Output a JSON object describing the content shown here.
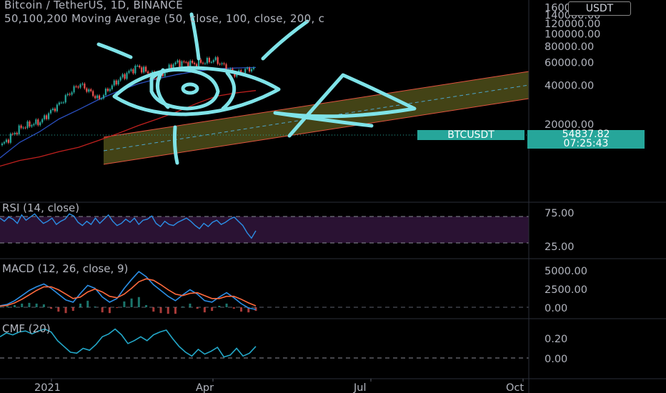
{
  "header": {
    "title": "Bitcoin / TetherUS, 1D, BINANCE",
    "indicator": "50,100,200 Moving Average (50, close, 100, close, 200, c"
  },
  "unit_button": "USDT",
  "price_label": {
    "symbol": "BTCUSDT",
    "price": "54837.82",
    "countdown": "07:25:43"
  },
  "colors": {
    "background": "#000000",
    "price": "#26a69a",
    "channel_fill": "#5a5a1e",
    "channel_line": "#e0533f",
    "drawing": "#7fe3e8",
    "rsi": "#2b8fe6",
    "rsi_band": "#2a1233",
    "macd": "#2b8fe6",
    "macd_signal": "#ff6a3d",
    "cmf": "#23a8c9",
    "ma50": "#2a4fbf",
    "ma200": "#c0201e",
    "text": "#b2b5be"
  },
  "chart_data": [
    {
      "type": "line",
      "name": "price",
      "x_ticks": [
        "2021",
        "Apr",
        "Jul",
        "Oct"
      ],
      "y_ticks": [
        20000,
        40000,
        60000,
        80000,
        100000,
        120000,
        140000,
        160000
      ],
      "ylim": [
        5000,
        165000
      ],
      "scale": "log",
      "x": [
        "2020-11-01",
        "2020-12-01",
        "2020-12-15",
        "2021-01-01",
        "2021-01-08",
        "2021-01-22",
        "2021-02-08",
        "2021-02-21",
        "2021-03-01",
        "2021-03-13",
        "2021-04-01",
        "2021-04-14",
        "2021-04-25",
        "2021-05-03"
      ],
      "values": [
        13800,
        19000,
        21000,
        29000,
        41000,
        31000,
        44000,
        56000,
        45000,
        60000,
        58800,
        63000,
        49000,
        54800
      ],
      "ma50": [
        11000,
        14500,
        17500,
        22000,
        26000,
        31000,
        36000,
        41000,
        45000,
        48500,
        51500,
        53800,
        54500,
        55000
      ],
      "ma200": [
        9500,
        10500,
        11200,
        12300,
        13300,
        15000,
        17000,
        19500,
        22000,
        25000,
        29000,
        33000,
        35000,
        36500
      ],
      "current": 54837.82
    },
    {
      "type": "line",
      "name": "RSI (14, close)",
      "levels": [
        75,
        25
      ],
      "ylim": [
        10,
        90
      ],
      "values": [
        72,
        66,
        74,
        70,
        62,
        78,
        68,
        74,
        80,
        70,
        62,
        66,
        72,
        60,
        66,
        70,
        80,
        76,
        64,
        58,
        66,
        60,
        72,
        62,
        70,
        78,
        66,
        58,
        62,
        70,
        64,
        72,
        60,
        68,
        70,
        76,
        62,
        56,
        66,
        60,
        58,
        64,
        68,
        72,
        66,
        58,
        52,
        62,
        56,
        64,
        68,
        60,
        64,
        70,
        74,
        66,
        58,
        44,
        34,
        48
      ],
      "tick_labels": [
        "75.00",
        "25.00"
      ]
    },
    {
      "type": "line",
      "name": "MACD (12, 26, close, 9)",
      "ylim": [
        -1200,
        5800
      ],
      "macd": [
        200,
        400,
        900,
        1600,
        2300,
        2800,
        3200,
        2600,
        1800,
        1000,
        700,
        1900,
        3000,
        2600,
        1400,
        700,
        1200,
        2600,
        3800,
        4900,
        4200,
        3100,
        2300,
        1500,
        900,
        1700,
        2400,
        1800,
        900,
        700,
        1400,
        2000,
        1300,
        500,
        -100,
        -300
      ],
      "signal": [
        150,
        250,
        600,
        1100,
        1700,
        2300,
        2800,
        2800,
        2400,
        1800,
        1200,
        1400,
        2100,
        2500,
        2100,
        1500,
        1300,
        1800,
        2600,
        3500,
        3900,
        3700,
        3100,
        2400,
        1800,
        1600,
        1900,
        2000,
        1600,
        1200,
        1200,
        1500,
        1500,
        1100,
        600,
        200
      ],
      "tick_labels": [
        "5000.00",
        "2500.00",
        "0.00"
      ]
    },
    {
      "type": "line",
      "name": "CMF (20)",
      "ylim": [
        -0.05,
        0.35
      ],
      "values": [
        0.22,
        0.26,
        0.24,
        0.27,
        0.28,
        0.25,
        0.28,
        0.3,
        0.27,
        0.18,
        0.12,
        0.06,
        0.05,
        0.1,
        0.08,
        0.14,
        0.22,
        0.25,
        0.3,
        0.24,
        0.15,
        0.18,
        0.22,
        0.18,
        0.24,
        0.27,
        0.29,
        0.2,
        0.12,
        0.06,
        0.02,
        0.09,
        0.04,
        0.07,
        0.11,
        0.01,
        0.03,
        0.1,
        0.02,
        0.05,
        0.12
      ],
      "tick_labels": [
        "0.20",
        "0.00"
      ]
    }
  ]
}
